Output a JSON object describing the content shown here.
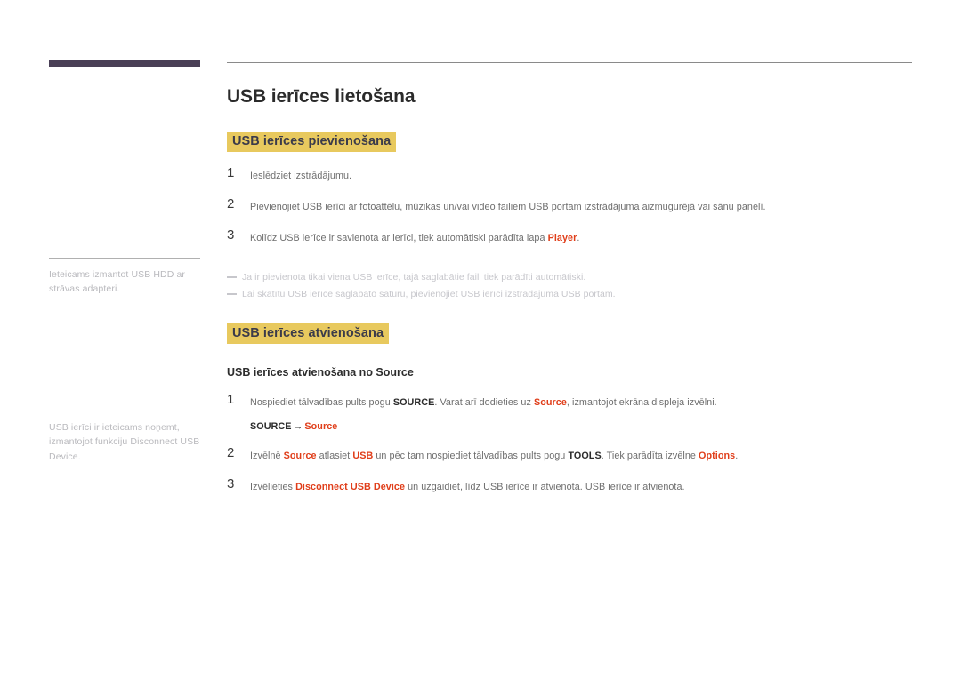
{
  "page": {
    "brand_bar_color": "#4a3f56",
    "highlight_color": "#e8c95e",
    "accent_color": "#e03e1a"
  },
  "title": "USB ierīces lietošana",
  "sections": [
    {
      "heading": "USB ierīces pievienošana",
      "steps": [
        {
          "num": "1",
          "parts": [
            {
              "t": "Ieslēdziet izstrādājumu.",
              "s": "normal"
            }
          ]
        },
        {
          "num": "2",
          "parts": [
            {
              "t": "Pievienojiet USB ierīci ar fotoattēlu, mūzikas un/vai video failiem USB portam izstrādājuma aizmugurējā vai sānu panelī.",
              "s": "normal"
            }
          ]
        },
        {
          "num": "3",
          "parts": [
            {
              "t": "Kolīdz USB ierīce ir savienota ar ierīci, tiek automātiski parādīta lapa ",
              "s": "normal"
            },
            {
              "t": "Player",
              "s": "accent"
            },
            {
              "t": ".",
              "s": "normal"
            }
          ]
        }
      ],
      "notes": [
        "Ja ir pievienota tikai viena USB ierīce, tajā saglabātie faili tiek parādīti automātiski.",
        "Lai skatītu USB ierīcē saglabāto saturu, pievienojiet USB ierīci izstrādājuma USB portam."
      ]
    },
    {
      "heading": "USB ierīces atvienošana",
      "sub_heading": "USB ierīces atvienošana no Source",
      "steps": [
        {
          "num": "1",
          "parts": [
            {
              "t": "Nospiediet tālvadības pults pogu ",
              "s": "normal"
            },
            {
              "t": "SOURCE",
              "s": "bold"
            },
            {
              "t": ". Varat arī dodieties uz ",
              "s": "normal"
            },
            {
              "t": "Source",
              "s": "accent"
            },
            {
              "t": ", izmantojot ekrāna displeja izvēlni.",
              "s": "normal"
            }
          ]
        },
        {
          "num": "2",
          "parts": [
            {
              "t": "Izvēlnē ",
              "s": "normal"
            },
            {
              "t": "Source",
              "s": "accent"
            },
            {
              "t": " atlasiet ",
              "s": "normal"
            },
            {
              "t": "USB",
              "s": "accent"
            },
            {
              "t": " un pēc tam nospiediet tālvadības pults pogu ",
              "s": "normal"
            },
            {
              "t": "TOOLS",
              "s": "bold"
            },
            {
              "t": ". Tiek parādīta izvēlne ",
              "s": "normal"
            },
            {
              "t": "Options",
              "s": "accent"
            },
            {
              "t": ".",
              "s": "normal"
            }
          ]
        },
        {
          "num": "3",
          "parts": [
            {
              "t": "Izvēlieties ",
              "s": "normal"
            },
            {
              "t": "Disconnect USB Device",
              "s": "accent"
            },
            {
              "t": " un uzgaidiet, līdz USB ierīce ir atvienota. USB ierīce ir atvienota.",
              "s": "normal"
            }
          ]
        }
      ],
      "path": {
        "root": "SOURCE",
        "arrow": "→",
        "target": "Source"
      }
    }
  ],
  "sidebar": {
    "notes": [
      {
        "parts": [
          {
            "t": "Ieteicams izmantot USB HDD ar strāvas adapteri.",
            "s": "normal"
          }
        ]
      },
      {
        "parts": [
          {
            "t": "USB ierīci ir ieteicams noņemt, izmantojot funkciju ",
            "s": "normal"
          },
          {
            "t": "Disconnect USB Device",
            "s": "accent"
          },
          {
            "t": ".",
            "s": "normal"
          }
        ]
      }
    ]
  }
}
